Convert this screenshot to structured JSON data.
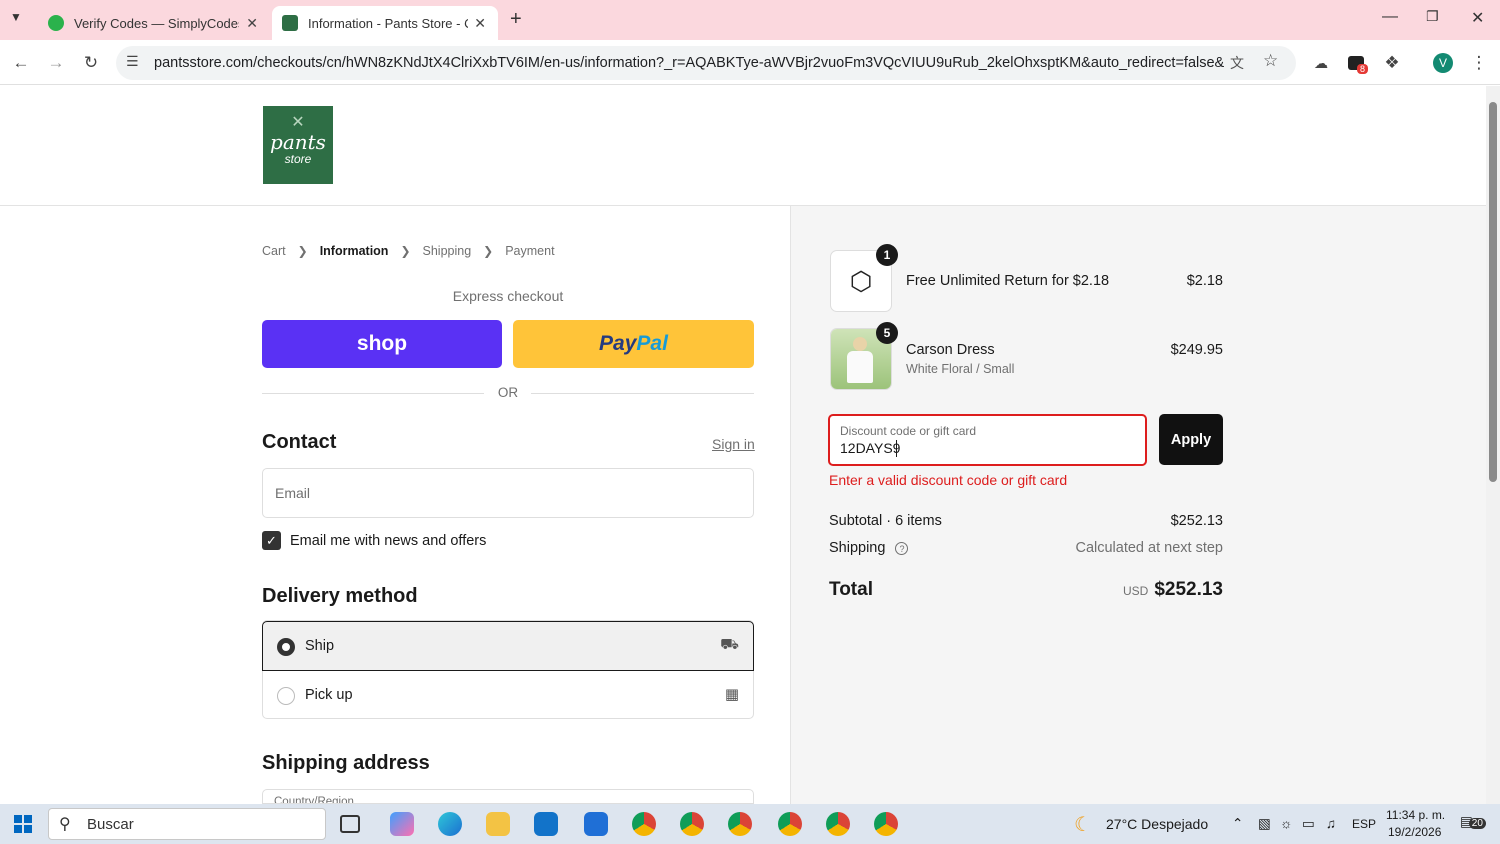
{
  "browser": {
    "tabs": [
      {
        "title": "Verify Codes — SimplyCodes",
        "active": false
      },
      {
        "title": "Information - Pants Store - Checkout",
        "active": true
      }
    ],
    "url": "pantsstore.com/checkouts/cn/hWN8zKNdJtX4ClriXxbTV6IM/en-us/information?_r=AQABKTye-aWVBjr2vuoFm3VQcVIUU9uRub_2kelOhxsptKM&auto_redirect=false&edge_redi...",
    "profile_initial": "V",
    "extension_badge": "8"
  },
  "header": {
    "logo_line1": "pants",
    "logo_line2": "store",
    "brand_color": "#2e6e45"
  },
  "breadcrumb": {
    "items": [
      "Cart",
      "Information",
      "Shipping",
      "Payment"
    ],
    "separator": ">"
  },
  "express": {
    "heading": "Express checkout",
    "shop_label": "shop",
    "paypal_label_a": "Pay",
    "paypal_label_b": "Pal",
    "or_label": "OR"
  },
  "contact": {
    "heading": "Contact",
    "signin_label": "Sign in",
    "email_placeholder": "Email",
    "newsletter_label": "Email me with news and offers",
    "newsletter_checked": true
  },
  "delivery": {
    "heading": "Delivery method",
    "options": [
      {
        "label": "Ship",
        "selected": true,
        "icon": "truck-icon"
      },
      {
        "label": "Pick up",
        "selected": false,
        "icon": "store-icon"
      }
    ]
  },
  "shipping_address": {
    "heading": "Shipping address",
    "country_label": "Country/Region"
  },
  "summary": {
    "items": [
      {
        "name": "Free Unlimited Return for $2.18",
        "variant": "",
        "qty": "1",
        "price": "$2.18",
        "icon": "package-icon"
      },
      {
        "name": "Carson Dress",
        "variant": "White Floral / Small",
        "qty": "5",
        "price": "$249.95",
        "icon": "dress-image"
      }
    ],
    "discount_label": "Discount code or gift card",
    "discount_value": "12DAYS9",
    "apply_label": "Apply",
    "error": "Enter a valid discount code or gift card",
    "subtotal_label": "Subtotal · 6 items",
    "subtotal_value": "$252.13",
    "shipping_label": "Shipping",
    "shipping_value": "Calculated at next step",
    "total_label": "Total",
    "total_currency": "USD",
    "total_value": "$252.13"
  },
  "taskbar": {
    "search_label": "Buscar",
    "weather": "27°C  Despejado",
    "lang": "ESP",
    "time": "11:34 p. m.",
    "date": "19/2/2026",
    "notifications": "20"
  }
}
